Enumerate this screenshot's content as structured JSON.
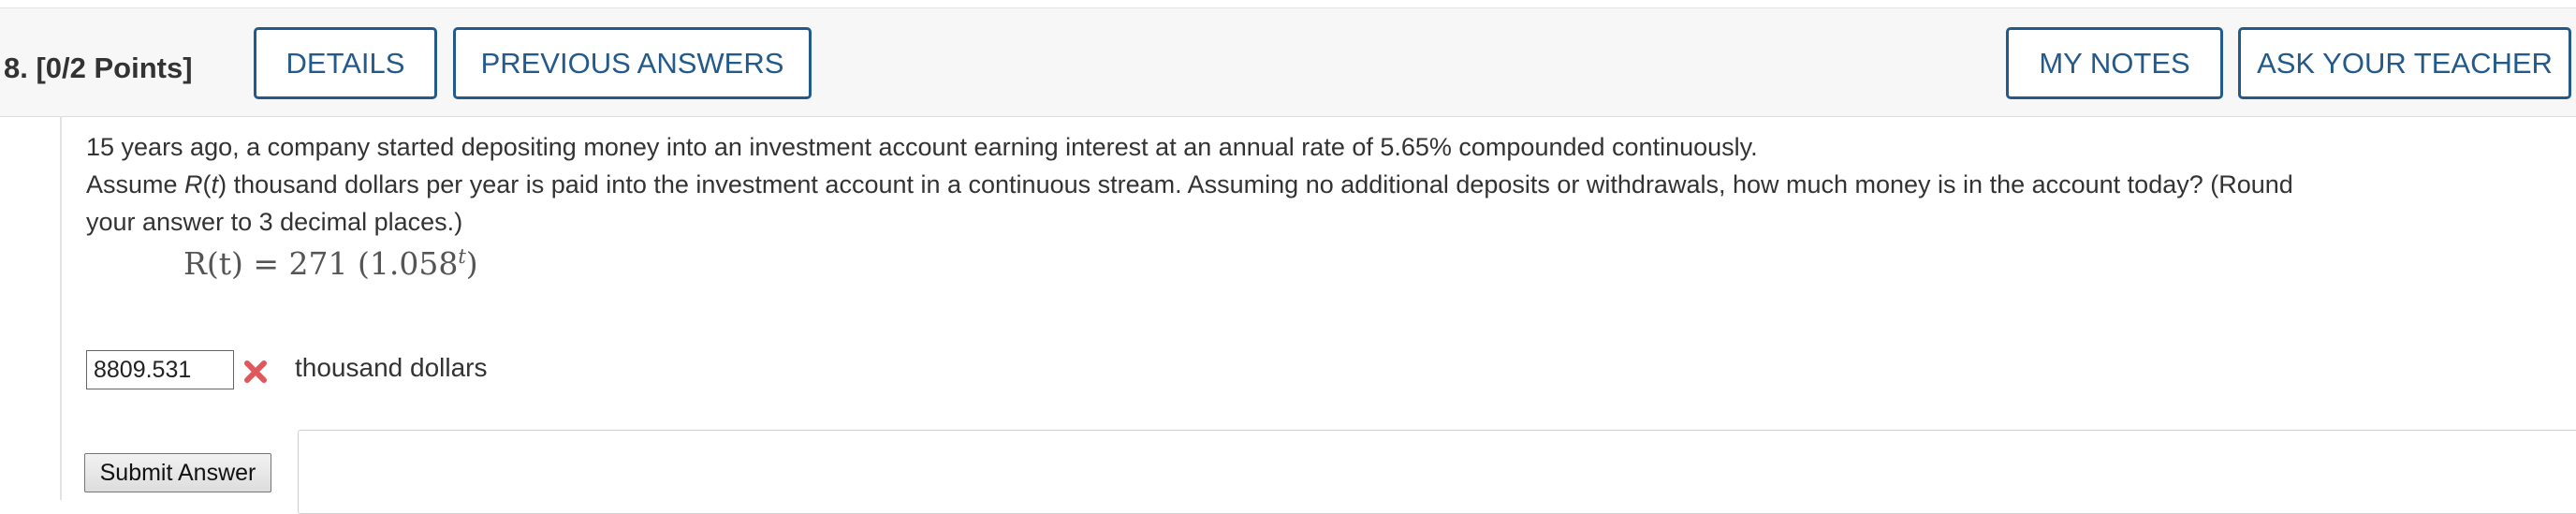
{
  "header": {
    "question_label": "8.  [0/2 Points]",
    "buttons": {
      "details": "DETAILS",
      "previous_answers": "PREVIOUS ANSWERS",
      "my_notes": "MY NOTES",
      "ask_teacher": "ASK YOUR TEACHER"
    }
  },
  "question": {
    "line1": "15 years ago, a company started depositing money into an investment account earning interest at an annual rate of 5.65% compounded continuously.",
    "line2_prefix": "Assume ",
    "line2_func": "R",
    "line2_arg": "t",
    "line2_suffix": " thousand dollars per year is paid into the investment account in a continuous stream. Assuming no additional deposits or withdrawals, how much money is in the account today? (Round",
    "line3": "your answer to 3 decimal places.)",
    "formula": {
      "lhs": "R(t) = 271 (1.058",
      "exponent": "t",
      "close": ")"
    }
  },
  "answer": {
    "value": "8809.531",
    "status_icon": "x-mark-icon",
    "unit": "thousand dollars"
  },
  "submit_label": "Submit Answer",
  "colors": {
    "accent": "#235a8c",
    "wrong": "#e0585b",
    "header_bg": "#f7f7f7"
  }
}
